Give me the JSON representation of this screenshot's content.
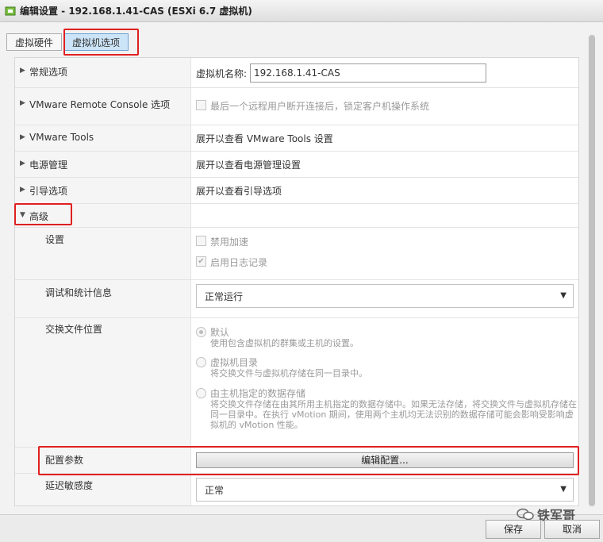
{
  "window": {
    "title": "编辑设置 - 192.168.1.41-CAS (ESXi 6.7 虚拟机)"
  },
  "tabs": [
    {
      "label": "虚拟硬件",
      "active": false
    },
    {
      "label": "虚拟机选项",
      "active": true
    }
  ],
  "rows": {
    "general": {
      "label": "常规选项",
      "field_label": "虚拟机名称:",
      "vm_name": "192.168.1.41-CAS"
    },
    "vmrc": {
      "label": "VMware Remote Console 选项",
      "option": "最后一个远程用户断开连接后，锁定客户机操作系统"
    },
    "vmtools": {
      "label": "VMware Tools",
      "value": "展开以查看 VMware Tools 设置"
    },
    "power": {
      "label": "电源管理",
      "value": "展开以查看电源管理设置"
    },
    "boot": {
      "label": "引导选项",
      "value": "展开以查看引导选项"
    },
    "advanced": {
      "label": "高级",
      "settings": {
        "label": "设置",
        "disable_accel": "禁用加速",
        "enable_logging": "启用日志记录"
      },
      "debug": {
        "label": "调试和统计信息",
        "selected": "正常运行"
      },
      "swap": {
        "label": "交换文件位置",
        "options": [
          {
            "title": "默认",
            "desc": "使用包含虚拟机的群集或主机的设置。",
            "checked": true
          },
          {
            "title": "虚拟机目录",
            "desc": "将交换文件与虚拟机存储在同一目录中。",
            "checked": false
          },
          {
            "title": "由主机指定的数据存储",
            "desc": "将交换文件存储在由其所用主机指定的数据存储中。如果无法存储，将交换文件与虚拟机存储在同一目录中。在执行 vMotion 期间，使用两个主机均无法识别的数据存储可能会影响受影响虚拟机的 vMotion 性能。",
            "checked": false
          }
        ]
      },
      "config": {
        "label": "配置参数",
        "button": "编辑配置..."
      },
      "latency": {
        "label": "延迟敏感度",
        "selected": "正常"
      }
    }
  },
  "footer": {
    "save": "保存",
    "cancel": "取消"
  },
  "watermark": {
    "text": "铁军哥"
  },
  "colors": {
    "highlight": "#e02020",
    "active_tab": "#cce4f7"
  }
}
